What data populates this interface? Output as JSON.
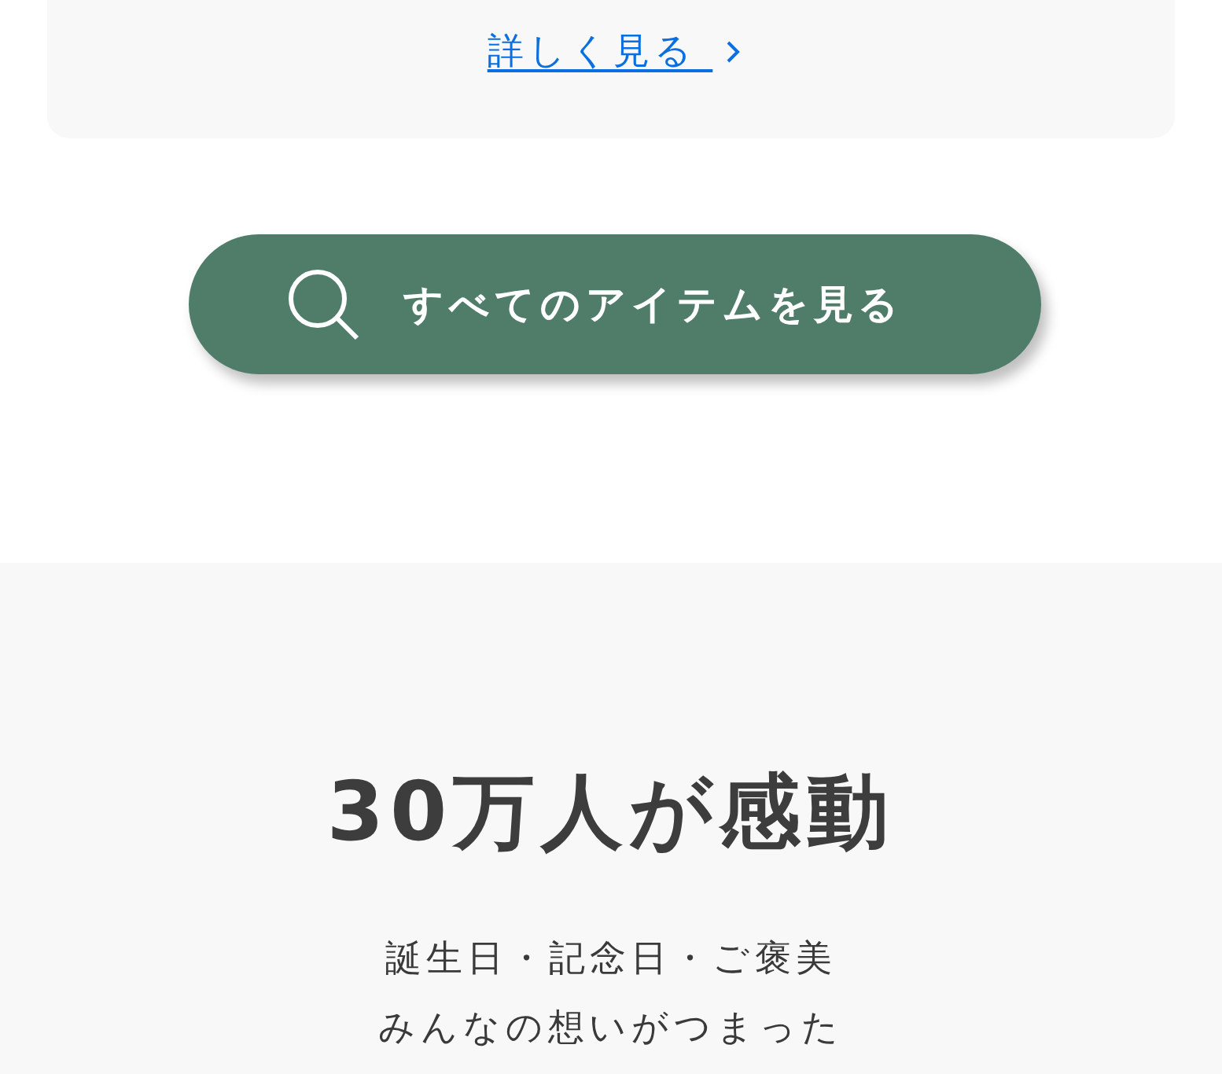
{
  "card": {
    "link": "詳しく見る "
  },
  "all_items_button": {
    "label": "すべてのアイテムを見る"
  },
  "section": {
    "heading": "30万人が感動",
    "lines": [
      "誕生日・記念日・ご褒美",
      "みんなの想いがつまった"
    ]
  }
}
